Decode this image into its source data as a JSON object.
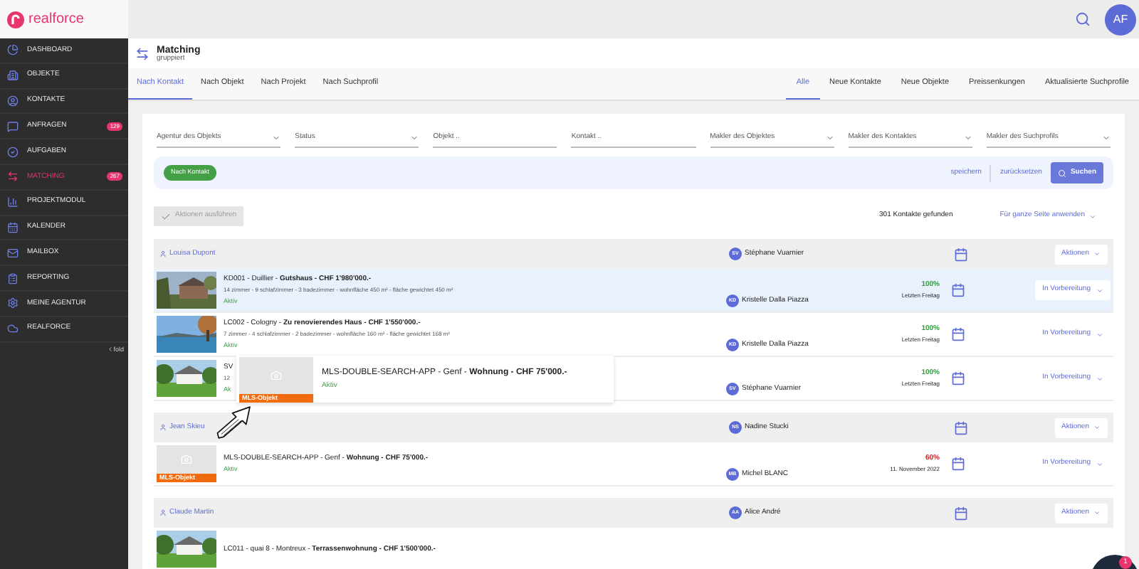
{
  "app": {
    "logo_text": "realforce",
    "user_initials": "AF"
  },
  "sidebar": {
    "items": [
      {
        "label": "DASHBOARD",
        "selected": false
      },
      {
        "label": "OBJEKTE",
        "selected": false
      },
      {
        "label": "KONTAKTE",
        "selected": false
      },
      {
        "label": "ANFRAGEN",
        "selected": false,
        "badge": "129"
      },
      {
        "label": "AUFGABEN",
        "selected": false
      },
      {
        "label": "MATCHING",
        "selected": true,
        "badge": "267"
      },
      {
        "label": "PROJEKTMODUL",
        "selected": false
      },
      {
        "label": "KALENDER",
        "selected": false
      },
      {
        "label": "MAILBOX",
        "selected": false
      },
      {
        "label": "REPORTING",
        "selected": false
      },
      {
        "label": "MEINE AGENTUR",
        "selected": false
      },
      {
        "label": "REALFORCE",
        "selected": false
      }
    ],
    "fold_label": "fold"
  },
  "page": {
    "title": "Matching",
    "subtitle": "gruppiert"
  },
  "view_tabs": [
    {
      "label": "Nach Kontakt",
      "selected": true
    },
    {
      "label": "Nach Objekt",
      "selected": false
    },
    {
      "label": "Nach Projekt",
      "selected": false
    },
    {
      "label": "Nach Suchprofil",
      "selected": false
    }
  ],
  "filter_tabs": [
    {
      "label": "Alle",
      "selected": true
    },
    {
      "label": "Neue Kontakte",
      "selected": false
    },
    {
      "label": "Neue Objekte",
      "selected": false
    },
    {
      "label": "Preissenkungen",
      "selected": false
    },
    {
      "label": "Aktualisierte Suchprofile",
      "selected": false
    }
  ],
  "filters": [
    {
      "label": "Agentur des Objekts",
      "kind": "select"
    },
    {
      "label": "Status",
      "kind": "select"
    },
    {
      "label": "Objekt ..",
      "kind": "text"
    },
    {
      "label": "Kontakt ..",
      "kind": "text"
    },
    {
      "label": "Makler des Objektes",
      "kind": "select"
    },
    {
      "label": "Makler des Kontaktes",
      "kind": "select"
    },
    {
      "label": "Makler des Suchprofils",
      "kind": "select"
    }
  ],
  "chip": "Nach Kontakt",
  "save_link": "speichern",
  "reset_link": "zurücksetzen",
  "search_button": "Suchen",
  "actions_button": {
    "label": "Aktionen ausführen",
    "disabled": true
  },
  "result_count": "301 Kontakte gefunden",
  "apply_all": "Für ganze Seite anwenden",
  "groups": [
    {
      "contact": "Louisa Dupont",
      "agent_initials": "SV",
      "agent": "Stéphane Vuarnier",
      "actions": "Aktionen",
      "rows": [
        {
          "kind": "picture",
          "title": "KD001 - Duillier - **Gutshaus - CHF 1'980'000.-**",
          "details": "14 zimmer - 9 schlafzimmer - 3 badezimmer - wohnfläche 450 m² - fläche gewichtet 450 m²",
          "status": "Aktiv",
          "agent_initials": "KD",
          "agent": "Kristelle Dalla Piazza",
          "score": "100%",
          "color": "#2e9d3a",
          "date": "Letzten Freitag",
          "state": "In Vorbereitung",
          "selected": true
        },
        {
          "kind": "picture",
          "title": "LC002 - Cologny - **Zu renovierendes Haus - CHF 1'550'000.-**",
          "details": "7 zimmer - 4 schlafzimmer - 2 badezimmer - wohnfläche 160 m² - fläche gewichtet 168 m²",
          "status": "Aktiv",
          "agent_initials": "KD",
          "agent": "Kristelle Dalla Piazza",
          "score": "100%",
          "color": "#2e9d3a",
          "date": "Letzten Freitag",
          "state": "In Vorbereitung",
          "selected": false
        },
        {
          "kind": "picture",
          "title": "SV",
          "details": "12",
          "status": "Ak",
          "agent_initials": "SV",
          "agent": "Stéphane Vuarnier",
          "score": "100%",
          "color": "#2e9d3a",
          "date": "Letzten Freitag",
          "state": "In Vorbereitung",
          "selected": false,
          "popup": {
            "mls_label": "MLS-Objekt",
            "title": "MLS-DOUBLE-SEARCH-APP - Genf - **Wohnung - CHF 75'000.-**",
            "status": "Aktiv"
          }
        }
      ]
    },
    {
      "contact": "Jean Skieu",
      "agent_initials": "NS",
      "agent": "Nadine Stucki",
      "actions": "Aktionen",
      "rows": [
        {
          "kind": "placeholder",
          "mls_label": "MLS-Objekt",
          "title": "MLS-DOUBLE-SEARCH-APP - Genf - **Wohnung - CHF 75'000.-**",
          "status": "Aktiv",
          "agent_initials": "MB",
          "agent": "Michel BLANC",
          "score": "60%",
          "color": "#d91c1c",
          "date": "11. November 2022",
          "state": "In Vorbereitung",
          "selected": false
        }
      ]
    },
    {
      "contact": "Claude Martin",
      "agent_initials": "AA",
      "agent": "Alice André",
      "actions": "Aktionen",
      "rows": [
        {
          "kind": "picture",
          "title": "LC011 - quai 8 - Montreux - **Terrassenwohnung - CHF 1'500'000.-**",
          "selected": false
        }
      ]
    }
  ],
  "chat": {
    "badge": "1"
  }
}
